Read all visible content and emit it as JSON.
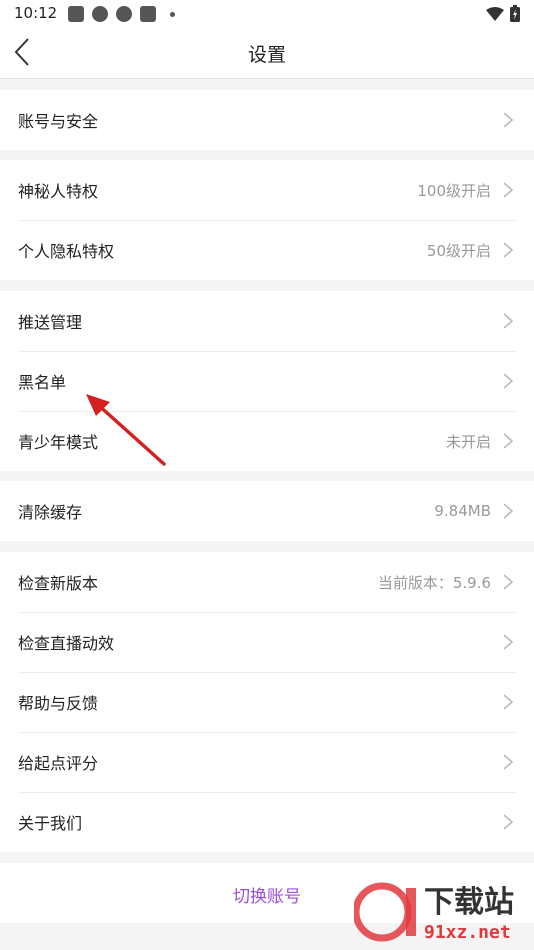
{
  "status": {
    "time": "10:12"
  },
  "header": {
    "title": "设置"
  },
  "groups": [
    {
      "items": [
        {
          "label": "账号与安全",
          "value": ""
        }
      ]
    },
    {
      "items": [
        {
          "label": "神秘人特权",
          "value": "100级开启"
        },
        {
          "label": "个人隐私特权",
          "value": "50级开启"
        }
      ]
    },
    {
      "items": [
        {
          "label": "推送管理",
          "value": ""
        },
        {
          "label": "黑名单",
          "value": ""
        },
        {
          "label": "青少年模式",
          "value": "未开启"
        }
      ]
    },
    {
      "items": [
        {
          "label": "清除缓存",
          "value": "9.84MB"
        }
      ]
    },
    {
      "items": [
        {
          "label": "检查新版本",
          "value": "当前版本：5.9.6"
        },
        {
          "label": "检查直播动效",
          "value": ""
        },
        {
          "label": "帮助与反馈",
          "value": ""
        },
        {
          "label": "给起点评分",
          "value": ""
        },
        {
          "label": "关于我们",
          "value": ""
        }
      ]
    }
  ],
  "switch_account": {
    "label": "切换账号"
  },
  "watermark": {
    "big": "下载站",
    "small": "91xz.net"
  },
  "colors": {
    "accent": "#9b4ddb",
    "annotation_arrow": "#d42020",
    "watermark": "#e0393e"
  }
}
